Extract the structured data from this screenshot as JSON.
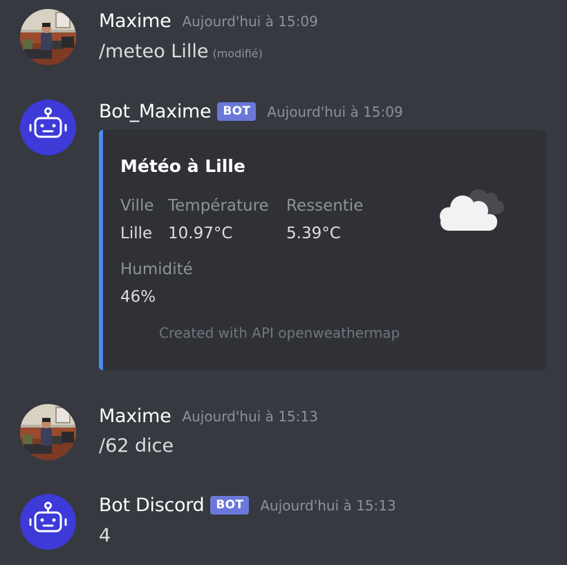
{
  "messages": [
    {
      "username": "Maxime",
      "timestamp": "Aujourd'hui à 15:09",
      "content": "/meteo Lille",
      "edited": "(modifié)",
      "avatar": "user-photo"
    },
    {
      "username": "Bot_Maxime",
      "bot_tag": "BOT",
      "timestamp": "Aujourd'hui à 15:09",
      "avatar": "robot-icon",
      "embed": {
        "title": "Météo à Lille",
        "accent_color": "#4e8bf0",
        "fields": [
          {
            "name": "Ville",
            "value": "Lille"
          },
          {
            "name": "Température",
            "value": "10.97°C"
          },
          {
            "name": "Ressentie",
            "value": "5.39°C"
          },
          {
            "name": "Humidité",
            "value": "46%"
          }
        ],
        "footer": "Created with API openweathermap",
        "thumbnail": "cloud-icon"
      }
    },
    {
      "username": "Maxime",
      "timestamp": "Aujourd'hui à 15:13",
      "content": "/62 dice",
      "avatar": "user-photo"
    },
    {
      "username": "Bot Discord",
      "bot_tag": "BOT",
      "timestamp": "Aujourd'hui à 15:13",
      "content": "4",
      "avatar": "robot-icon"
    }
  ],
  "colors": {
    "background": "#36393f",
    "embed_background": "#2f3136",
    "bot_tag": "#6b78d9",
    "bot_avatar": "#3d3ad8"
  }
}
